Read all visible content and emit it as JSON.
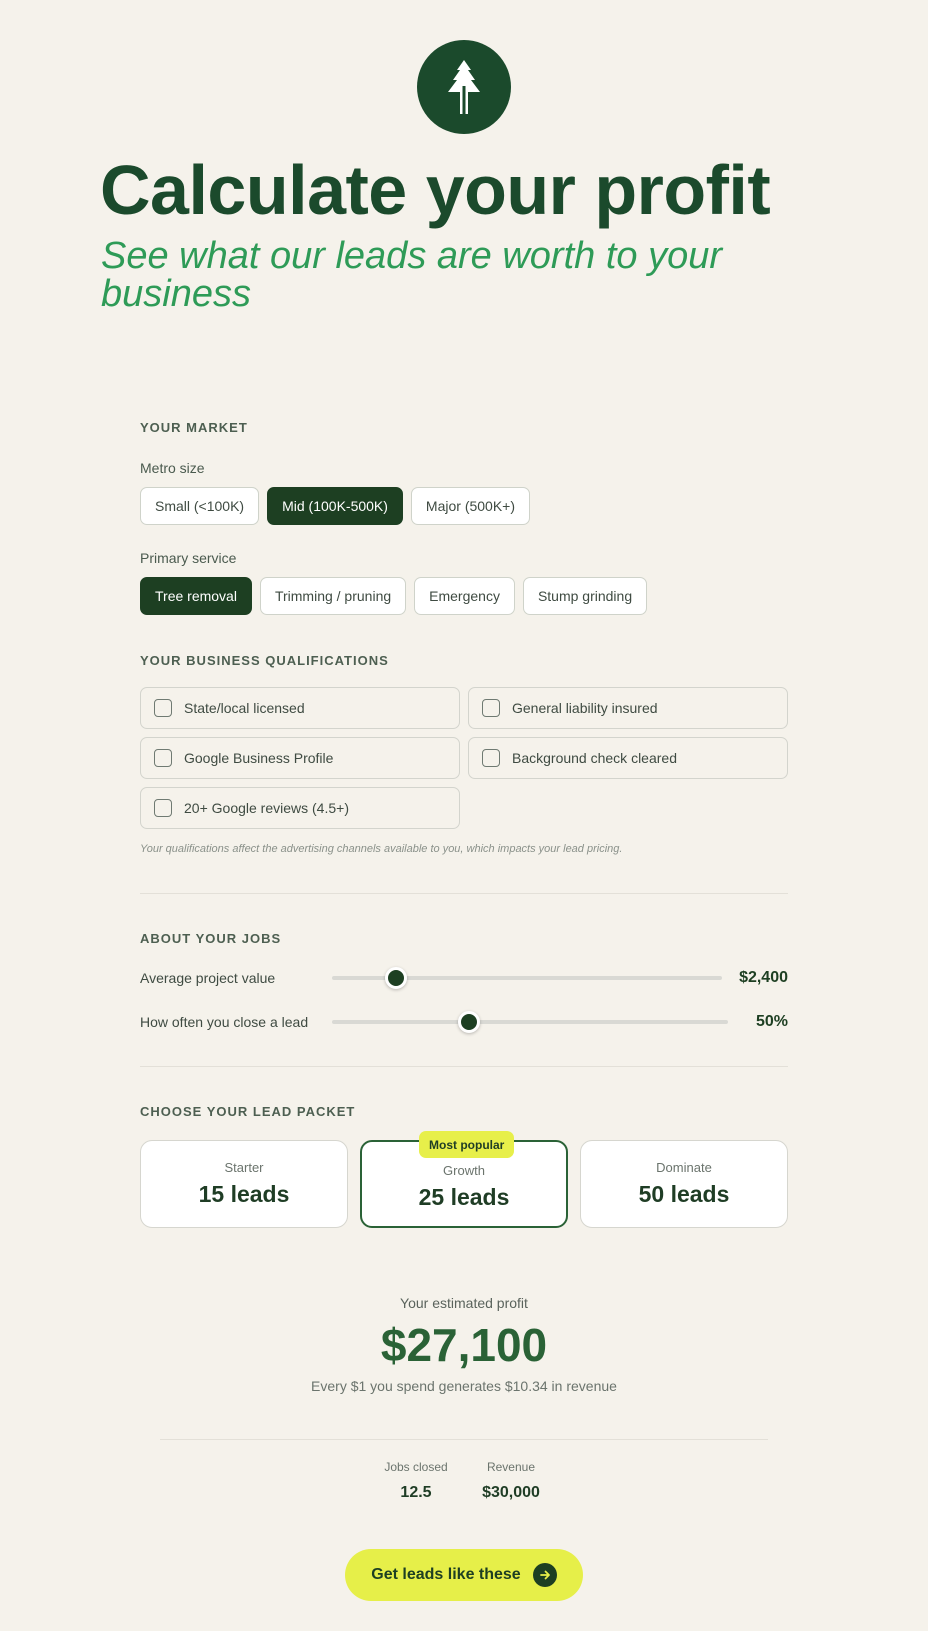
{
  "header": {
    "logo_icon": "tree-icon",
    "title": "Calculate your profit",
    "subtitle": "See what our leads are worth to your business"
  },
  "market": {
    "section_label": "YOUR MARKET",
    "metro_label": "Metro size",
    "metro_options": [
      "Small (<100K)",
      "Mid (100K-500K)",
      "Major (500K+)"
    ],
    "metro_selected": "Mid (100K-500K)",
    "service_label": "Primary service",
    "service_options": [
      "Tree removal",
      "Trimming / pruning",
      "Emergency",
      "Stump grinding"
    ],
    "service_selected": "Tree removal"
  },
  "qualifications": {
    "section_label": "YOUR BUSINESS QUALIFICATIONS",
    "items": [
      {
        "label": "State/local licensed",
        "checked": false
      },
      {
        "label": "General liability insured",
        "checked": false
      },
      {
        "label": "Google Business Profile",
        "checked": false
      },
      {
        "label": "Background check cleared",
        "checked": false
      },
      {
        "label": "20+ Google reviews (4.5+)",
        "checked": false
      }
    ],
    "note": "Your qualifications affect the advertising channels available to you, which impacts your lead pricing."
  },
  "jobs": {
    "section_label": "ABOUT YOUR JOBS",
    "project_value_label": "Average project value",
    "project_value": "$2,400",
    "project_value_fraction": 0.165,
    "close_rate_label": "How often you close a lead",
    "close_rate": "50%",
    "close_rate_fraction": 0.346
  },
  "packets": {
    "section_label": "CHOOSE YOUR LEAD PACKET",
    "badge": "Most popular",
    "items": [
      {
        "name": "Starter",
        "count": "15 leads"
      },
      {
        "name": "Growth",
        "count": "25 leads"
      },
      {
        "name": "Dominate",
        "count": "50 leads"
      }
    ],
    "selected": "Growth"
  },
  "results": {
    "profit_label": "Your estimated profit",
    "profit_value": "$27,100",
    "roi_text": "Every $1 you spend generates $10.34 in revenue",
    "stats": [
      {
        "label": "Jobs closed",
        "value": "12.5"
      },
      {
        "label": "Revenue",
        "value": "$30,000"
      }
    ]
  },
  "cta": {
    "label": "Get leads like these",
    "icon": "arrow-right-icon"
  },
  "colors": {
    "background": "#f5f2eb",
    "brand_dark": "#1b4a2c",
    "accent_green": "#2e9b57",
    "cta_yellow": "#e6ef49"
  }
}
